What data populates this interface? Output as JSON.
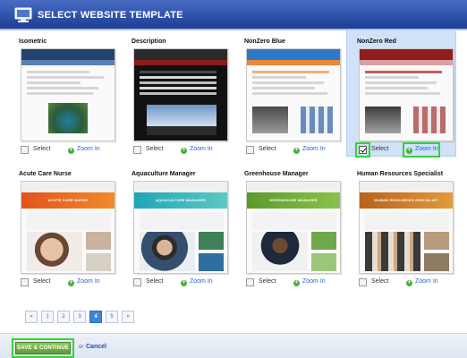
{
  "window": {
    "title": "SELECT WEBSITE TEMPLATE",
    "icon": "monitor-icon"
  },
  "templates": [
    {
      "name": "Isometric",
      "select_label": "Select",
      "zoom_label": "Zoom In",
      "selected": false
    },
    {
      "name": "Description",
      "select_label": "Select",
      "zoom_label": "Zoom In",
      "selected": false
    },
    {
      "name": "NonZero Blue",
      "select_label": "Select",
      "zoom_label": "Zoom In",
      "selected": false
    },
    {
      "name": "NonZero Red",
      "select_label": "Select",
      "zoom_label": "Zoom In",
      "selected": true
    },
    {
      "name": "Acute Care Nurse",
      "select_label": "Select",
      "zoom_label": "Zoom In",
      "selected": false
    },
    {
      "name": "Aquaculture Manager",
      "select_label": "Select",
      "zoom_label": "Zoom In",
      "selected": false
    },
    {
      "name": "Greenhouse Manager",
      "select_label": "Select",
      "zoom_label": "Zoom In",
      "selected": false
    },
    {
      "name": "Human Resources Specialist",
      "select_label": "Select",
      "zoom_label": "Zoom In",
      "selected": false
    }
  ],
  "thumb_text": {
    "acute": "ACUTE CARE NURSE",
    "aqua": "AQUACULTURE MANAGER",
    "green": "GREENHOUSE MANAGER",
    "hr": "HUMAN RESOURCES SPECIALIST"
  },
  "pagination": {
    "prev": "«",
    "pages": [
      "1",
      "2",
      "3",
      "4",
      "5"
    ],
    "current": "4",
    "next": "»"
  },
  "footer": {
    "save_label": "SAVE & CONTINUE",
    "or_text": "or",
    "cancel_label": "Cancel"
  },
  "colors": {
    "title_bar": "#2c4fa8",
    "selected_card": "#cfe2f7",
    "highlight": "#33d33a",
    "link": "#2a62c9",
    "save_button": "#5e9c35"
  }
}
